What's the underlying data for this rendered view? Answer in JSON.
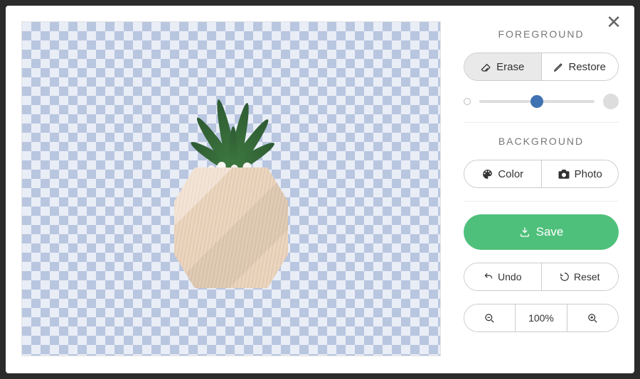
{
  "close_glyph": "✕",
  "foreground": {
    "title": "FOREGROUND",
    "erase_label": "Erase",
    "restore_label": "Restore",
    "brush_size_percent": 50
  },
  "background": {
    "title": "BACKGROUND",
    "color_label": "Color",
    "photo_label": "Photo"
  },
  "actions": {
    "save_label": "Save",
    "undo_label": "Undo",
    "reset_label": "Reset"
  },
  "zoom": {
    "level_label": "100%"
  }
}
